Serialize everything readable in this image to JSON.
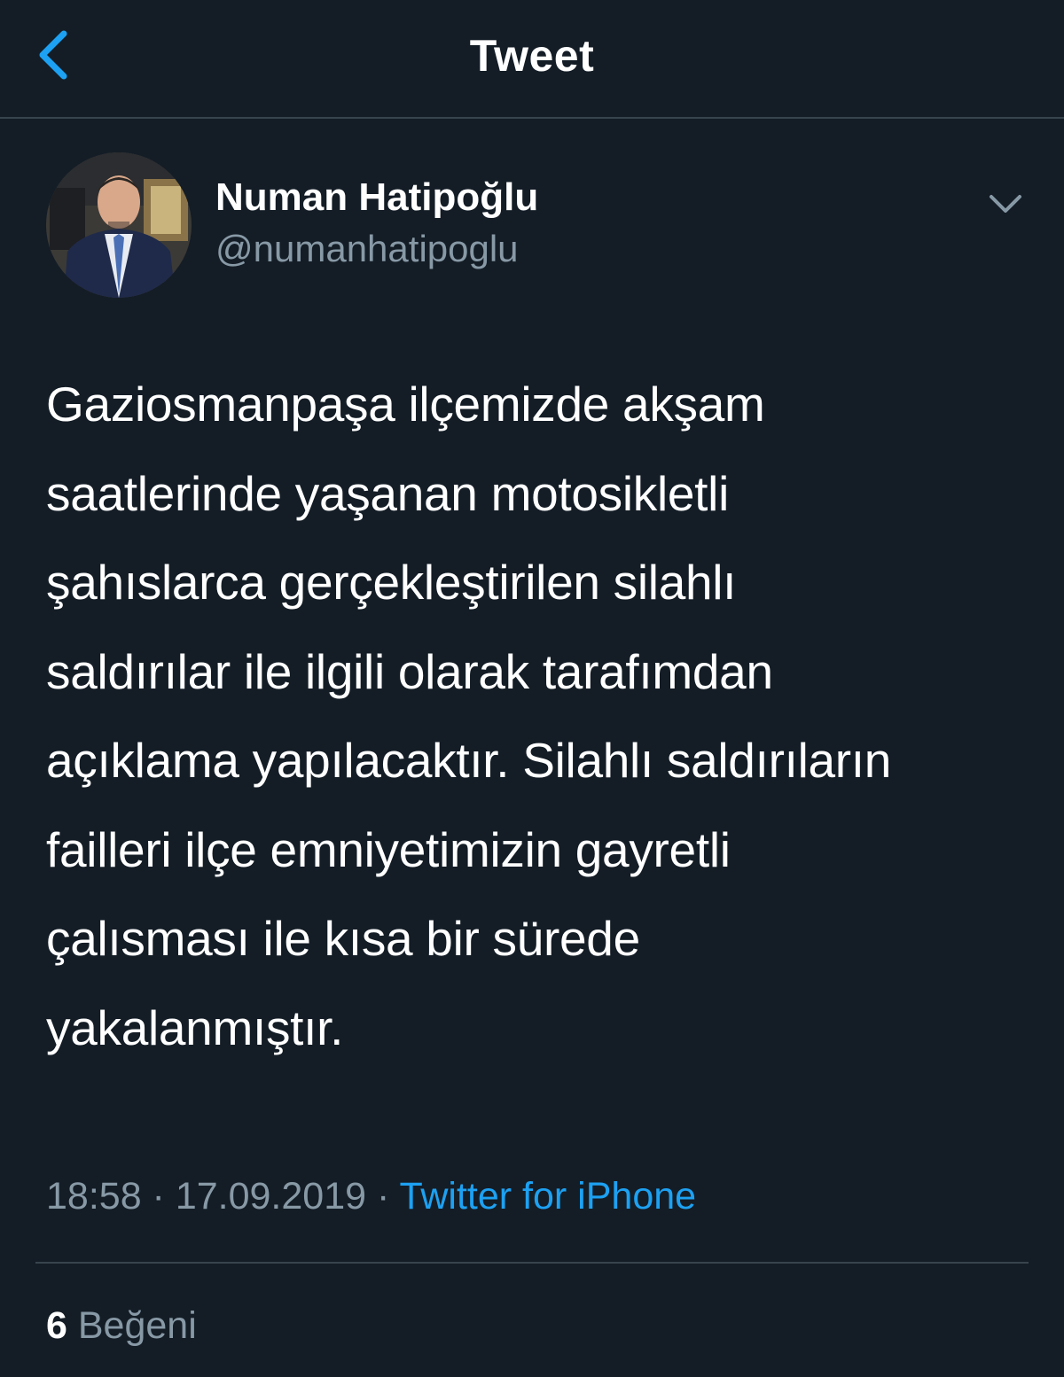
{
  "header": {
    "title": "Tweet",
    "back_icon": "chevron-left-icon"
  },
  "author": {
    "name": "Numan Hatipoğlu",
    "handle": "@numanhatipoglu",
    "avatar": "avatar-photo",
    "more_icon": "chevron-down-icon"
  },
  "tweet": {
    "text": "Gaziosmanpaşa ilçemizde akşam\nsaatlerinde yaşanan motosikletli\nşahıslarca gerçekleştirilen silahlı\nsaldırılar ile ilgili olarak tarafımdan\naçıklama yapılacaktır. Silahlı saldırıların\nfailleri ilçe emniyetimizin gayretli\nçalısması ile kısa bir sürede\nyakalanmıştır.",
    "time": "18:58",
    "date": "17.09.2019",
    "separator": " · ",
    "source": "Twitter for iPhone"
  },
  "stats": {
    "likes_count": "6",
    "likes_label": "Beğeni"
  },
  "colors": {
    "background": "#141d26",
    "accent": "#1da1f2",
    "secondary_text": "#8899a6",
    "divider": "#38444d"
  }
}
